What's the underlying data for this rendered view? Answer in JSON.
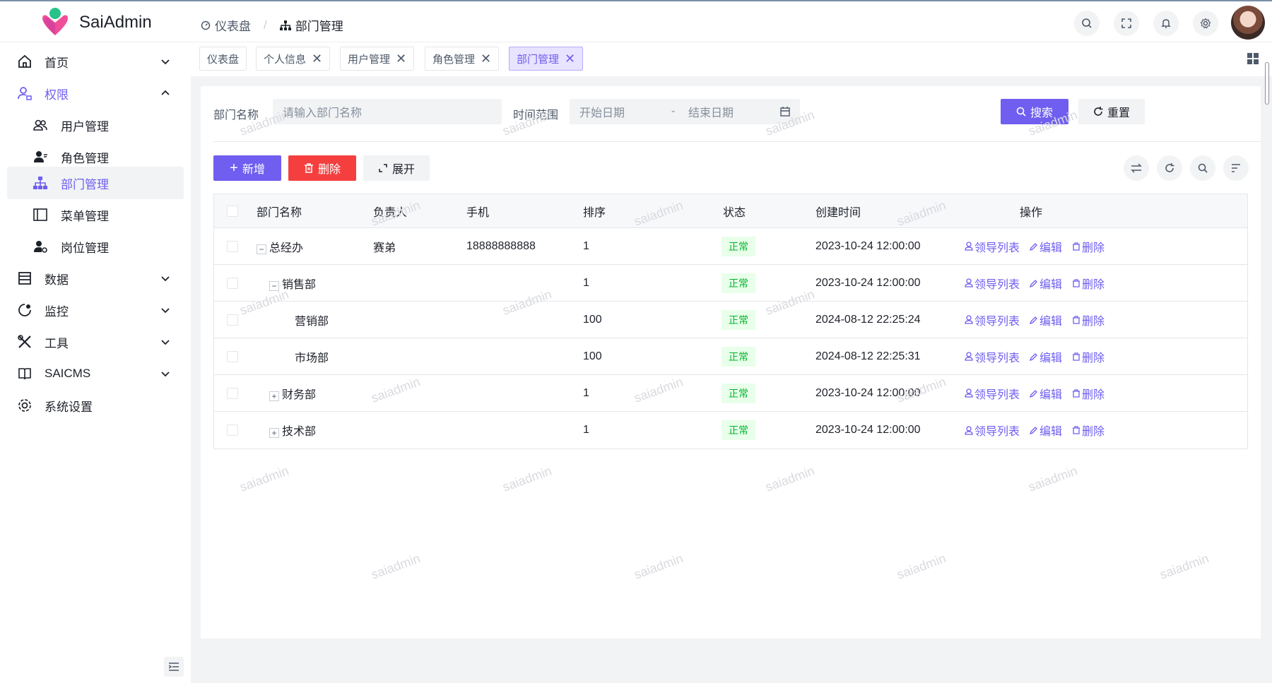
{
  "app": {
    "brand": "SaiAdmin"
  },
  "breadcrumb": {
    "home": "仪表盘",
    "current": "部门管理"
  },
  "sidebar": {
    "items": [
      {
        "label": "首页"
      },
      {
        "label": "权限"
      },
      {
        "label": "用户管理"
      },
      {
        "label": "角色管理"
      },
      {
        "label": "部门管理"
      },
      {
        "label": "菜单管理"
      },
      {
        "label": "岗位管理"
      },
      {
        "label": "数据"
      },
      {
        "label": "监控"
      },
      {
        "label": "工具"
      },
      {
        "label": "SAICMS"
      },
      {
        "label": "系统设置"
      }
    ]
  },
  "tabs": [
    "仪表盘",
    "个人信息",
    "用户管理",
    "角色管理",
    "部门管理"
  ],
  "search": {
    "dept_label": "部门名称",
    "dept_placeholder": "请输入部门名称",
    "time_label": "时间范围",
    "start_placeholder": "开始日期",
    "range_sep": "-",
    "end_placeholder": "结束日期",
    "search_btn": "搜索",
    "reset_btn": "重置"
  },
  "toolbar": {
    "add": "新增",
    "delete": "删除",
    "expand": "展开"
  },
  "table": {
    "headers": [
      "部门名称",
      "负责人",
      "手机",
      "排序",
      "状态",
      "创建时间",
      "操作"
    ],
    "rows": [
      {
        "name": "总经办",
        "leader": "赛弟",
        "phone": "18888888888",
        "sort": "1",
        "status": "正常",
        "created": "2023-10-24 12:00:00"
      },
      {
        "name": "销售部",
        "leader": "",
        "phone": "",
        "sort": "1",
        "status": "正常",
        "created": "2023-10-24 12:00:00"
      },
      {
        "name": "营销部",
        "leader": "",
        "phone": "",
        "sort": "100",
        "status": "正常",
        "created": "2024-08-12 22:25:24"
      },
      {
        "name": "市场部",
        "leader": "",
        "phone": "",
        "sort": "100",
        "status": "正常",
        "created": "2024-08-12 22:25:31"
      },
      {
        "name": "财务部",
        "leader": "",
        "phone": "",
        "sort": "1",
        "status": "正常",
        "created": "2023-10-24 12:00:00"
      },
      {
        "name": "技术部",
        "leader": "",
        "phone": "",
        "sort": "1",
        "status": "正常",
        "created": "2023-10-24 12:00:00"
      }
    ],
    "ops": {
      "leaders": "领导列表",
      "edit": "编辑",
      "delete": "删除"
    }
  },
  "watermark": "saiadmin",
  "colors": {
    "accent": "#6f5ef0",
    "danger": "#f53f3f",
    "success": "#00b42a"
  }
}
